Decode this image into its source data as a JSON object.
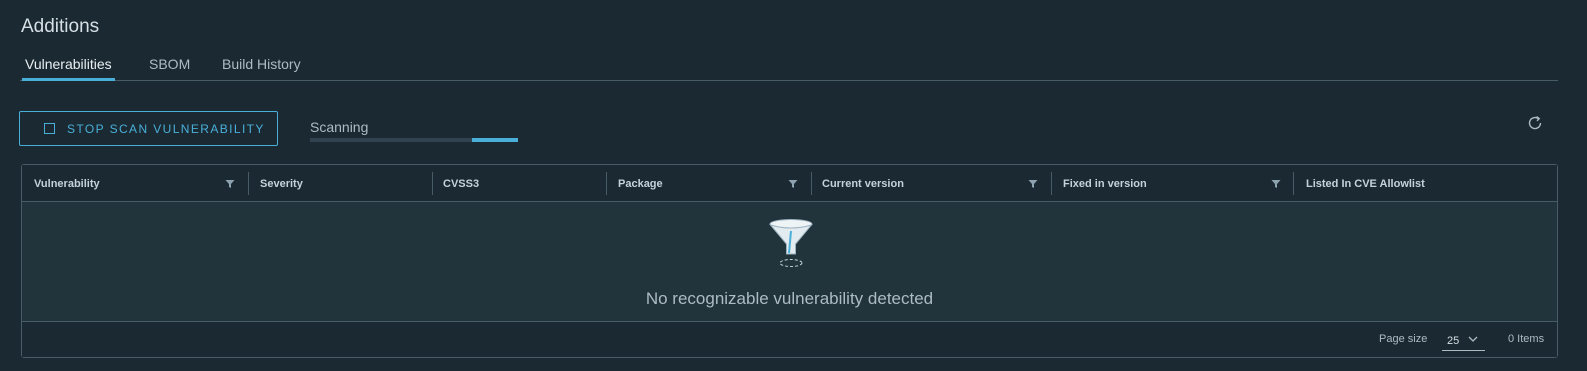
{
  "page": {
    "title": "Additions"
  },
  "tabs": [
    {
      "label": "Vulnerabilities",
      "active": true
    },
    {
      "label": "SBOM",
      "active": false
    },
    {
      "label": "Build History",
      "active": false
    }
  ],
  "toolbar": {
    "stop_scan_label": "STOP SCAN VULNERABILITY",
    "scan_status": "Scanning",
    "scan_progress": 0.22,
    "refresh_icon": "refresh-icon"
  },
  "grid": {
    "columns": [
      {
        "label": "Vulnerability",
        "filterable": true
      },
      {
        "label": "Severity",
        "filterable": false
      },
      {
        "label": "CVSS3",
        "filterable": false
      },
      {
        "label": "Package",
        "filterable": true
      },
      {
        "label": "Current version",
        "filterable": true
      },
      {
        "label": "Fixed in version",
        "filterable": true
      },
      {
        "label": "Listed In CVE Allowlist",
        "filterable": false
      }
    ],
    "empty_message": "No recognizable vulnerability detected",
    "footer": {
      "page_size_label": "Page size",
      "page_size_value": "25",
      "items_count": "0 Items"
    }
  },
  "colors": {
    "background": "#1b2a32",
    "accent": "#49afd9",
    "border": "#485c68"
  }
}
